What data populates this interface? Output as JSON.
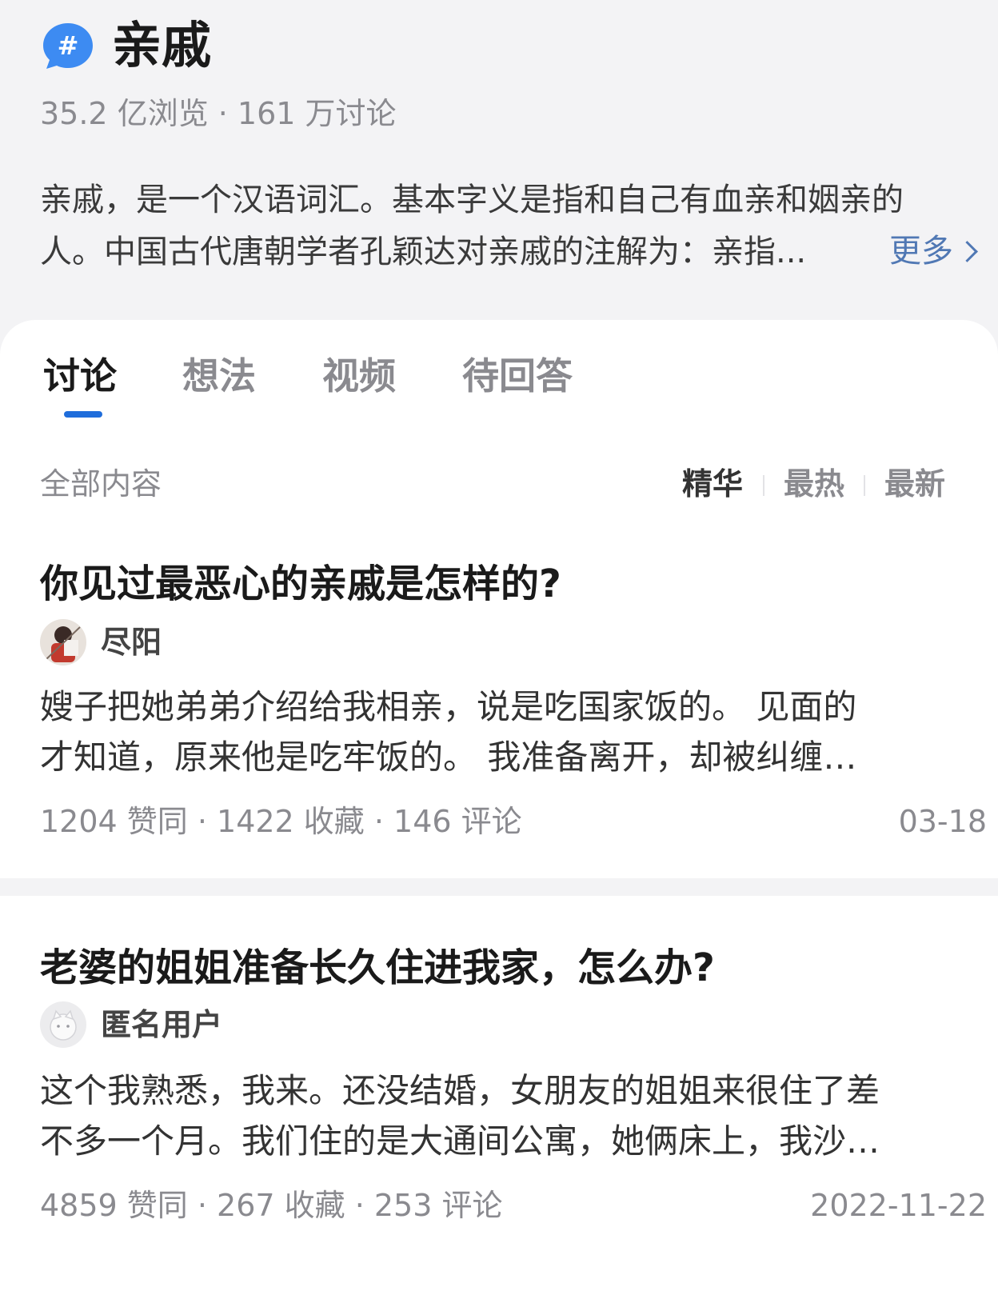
{
  "topic": {
    "icon": "hash-bubble-icon",
    "title": "亲戚",
    "stats": "35.2 亿浏览 · 161 万讨论",
    "description_line1": "亲戚，是一个汉语词汇。基本字义是指和自己有血亲和姻亲的",
    "description_line2": "人。中国古代唐朝学者孔颖达对亲戚的注解为：亲指...",
    "more_label": "更多"
  },
  "tabs": [
    {
      "label": "讨论",
      "active": true
    },
    {
      "label": "想法",
      "active": false
    },
    {
      "label": "视频",
      "active": false
    },
    {
      "label": "待回答",
      "active": false
    }
  ],
  "filter": {
    "label": "全部内容",
    "sorts": [
      {
        "label": "精华",
        "active": true
      },
      {
        "label": "最热",
        "active": false
      },
      {
        "label": "最新",
        "active": false
      }
    ]
  },
  "colors": {
    "accent": "#1f6ddb",
    "link": "#5078b4",
    "background": "#f3f3f5"
  },
  "posts": [
    {
      "title": "你见过最恶心的亲戚是怎样的?",
      "author": "尽阳",
      "excerpt_line1": "嫂子把她弟弟介绍给我相亲，说是吃国家饭的。 见面的",
      "excerpt_line2": "才知道，原来他是吃牢饭的。 我准备离开，却被纠缠…",
      "meta": "1204 赞同 · 1422 收藏 · 146 评论",
      "date": "03-18"
    },
    {
      "title": "老婆的姐姐准备长久住进我家，怎么办?",
      "author": "匿名用户",
      "excerpt_line1": "这个我熟悉，我来。还没结婚，女朋友的姐姐来很住了差",
      "excerpt_line2": "不多一个月。我们住的是大通间公寓，她俩床上，我沙…",
      "meta": "4859 赞同 · 267 收藏 · 253 评论",
      "date": "2022-11-22"
    }
  ]
}
